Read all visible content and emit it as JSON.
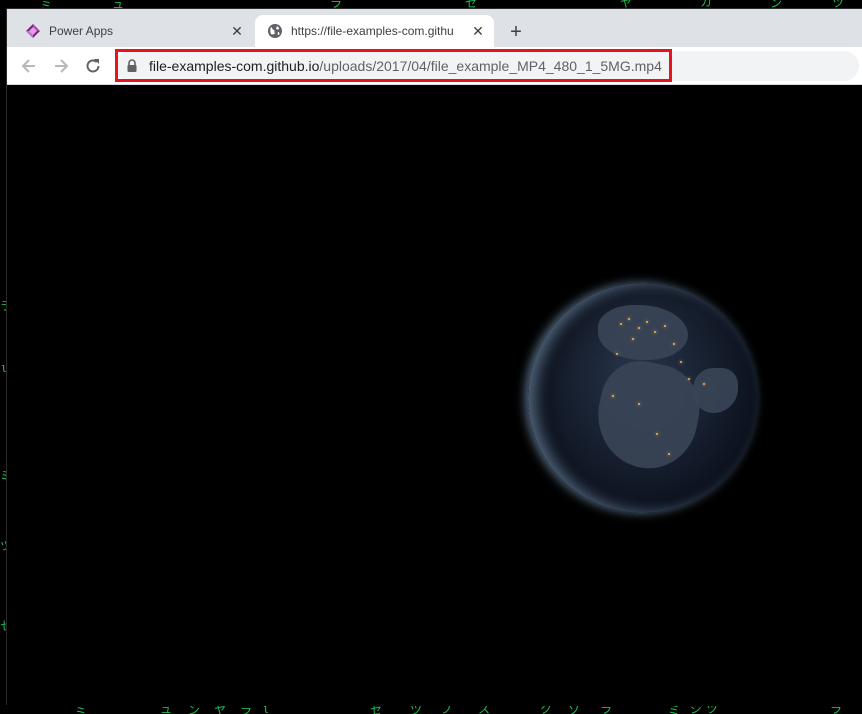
{
  "browser": {
    "tabs": [
      {
        "label": "Power Apps",
        "icon": "power-apps-icon",
        "active": false
      },
      {
        "label": "https://file-examples-com.githu",
        "icon": "globe-icon",
        "active": true
      }
    ],
    "new_tab_label": "+",
    "close_glyph": "✕",
    "address": {
      "host": "file-examples-com.github.io",
      "path": "/uploads/2017/04/file_example_MP4_480_1_5MG.mp4"
    },
    "highlight_color": "#e8141d"
  },
  "content": {
    "type": "video",
    "subject": "earth-at-night"
  },
  "desktop": {
    "background": "matrix-rain",
    "chars_top": [
      "ミ",
      "ュ",
      "ラ",
      "セ",
      "ヤ",
      "カ",
      "ン",
      "ツ"
    ],
    "chars_bottom": [
      "ミ",
      "ュ",
      "ン",
      "ヤ",
      "ラ",
      "ι",
      "セ",
      "ツ",
      "フ",
      "ス",
      "ク",
      "ソ",
      "ラ",
      "ミ",
      "ジ",
      "ツ",
      "ラ"
    ],
    "chars_side": [
      "ラ",
      "ι",
      "ミ",
      "ツ",
      "セ",
      "ン",
      "ク",
      "ソ"
    ]
  }
}
